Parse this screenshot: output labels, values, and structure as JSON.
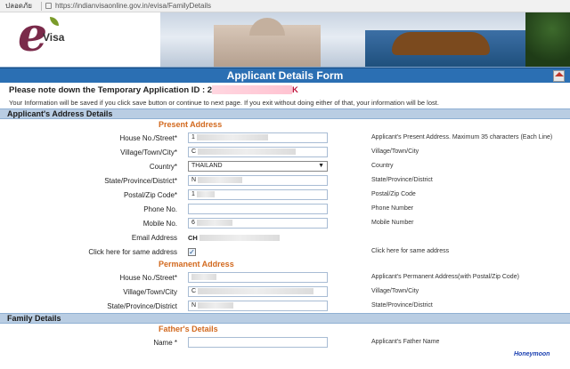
{
  "browser": {
    "tab_label": "ปลอดภัย",
    "url": "https://indianvisaonline.gov.in/evisa/FamilyDetails"
  },
  "banner": {
    "logo_letter": "e",
    "logo_text": "Visa"
  },
  "form": {
    "title": "Applicant Details Form",
    "temp_id_label": "Please note down the Temporary Application ID : 2",
    "temp_id_tail": "K",
    "info_text": "Your Information will be saved if you click save button or continue to next page. If you exit without doing either of that, your information will be lost."
  },
  "address_section": {
    "heading": "Applicant's Address Details",
    "present_heading": "Present Address",
    "fields": [
      {
        "label": "House No./Street*",
        "value": "1",
        "hint": "Applicant's Present Address. Maximum 35 characters (Each Line)"
      },
      {
        "label": "Village/Town/City*",
        "value": "C",
        "hint": "Village/Town/City"
      },
      {
        "label": "Country*",
        "value": "THAILAND",
        "hint": "Country"
      },
      {
        "label": "State/Province/District*",
        "value": "N",
        "hint": "State/Province/District"
      },
      {
        "label": "Postal/Zip Code*",
        "value": "1",
        "hint": "Postal/Zip Code"
      },
      {
        "label": "Phone No.",
        "value": "",
        "hint": "Phone Number"
      },
      {
        "label": "Mobile No.",
        "value": "6",
        "hint": "Mobile Number"
      },
      {
        "label": "Email Address",
        "value": "CH",
        "hint": ""
      },
      {
        "label": "Click here for same address",
        "value": "✓",
        "hint": "Click here for same address"
      }
    ],
    "permanent_heading": "Permanent Address",
    "permanent_fields": [
      {
        "label": "House No./Street*",
        "value": "",
        "hint": "Applicant's Permanent Address(with Postal/Zip Code)"
      },
      {
        "label": "Village/Town/City",
        "value": "C",
        "hint": "Village/Town/City"
      },
      {
        "label": "State/Province/District",
        "value": "N",
        "hint": "State/Province/District"
      }
    ]
  },
  "family_section": {
    "heading": "Family Details",
    "father_heading": "Father's Details",
    "fields": [
      {
        "label": "Name *",
        "value": "",
        "hint": "Applicant's Father Name"
      }
    ]
  },
  "watermark": "Honeymoon",
  "colors": {
    "title_bar": "#2b6fb3",
    "section_bar": "#b9cde3",
    "subheading": "#d2691e"
  }
}
